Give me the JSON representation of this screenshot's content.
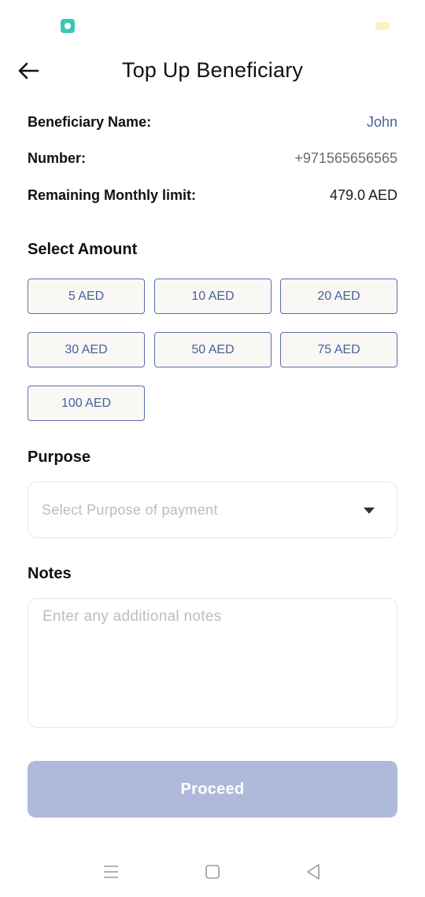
{
  "header": {
    "title": "Top Up Beneficiary",
    "back_icon": "arrow-left-icon"
  },
  "beneficiary": {
    "name_label": "Beneficiary Name:",
    "name_value": "John",
    "number_label": "Number:",
    "number_value": "+971565656565",
    "limit_label": "Remaining Monthly limit:",
    "limit_value": "479.0 AED"
  },
  "amount": {
    "title": "Select Amount",
    "options": [
      "5 AED",
      "10 AED",
      "20 AED",
      "30 AED",
      "50 AED",
      "75 AED",
      "100 AED"
    ]
  },
  "purpose": {
    "title": "Purpose",
    "placeholder": "Select Purpose of payment"
  },
  "notes": {
    "title": "Notes",
    "placeholder": "Enter any additional notes"
  },
  "proceed_label": "Proceed",
  "colors": {
    "accent": "#4a5f9e",
    "button_border": "#5b6eab",
    "proceed_disabled": "#afb9db",
    "chip_bg": "#f9f8f4"
  },
  "nav": {
    "menu_icon": "menu-icon",
    "home_icon": "square-home-icon",
    "back_icon": "triangle-back-icon"
  }
}
